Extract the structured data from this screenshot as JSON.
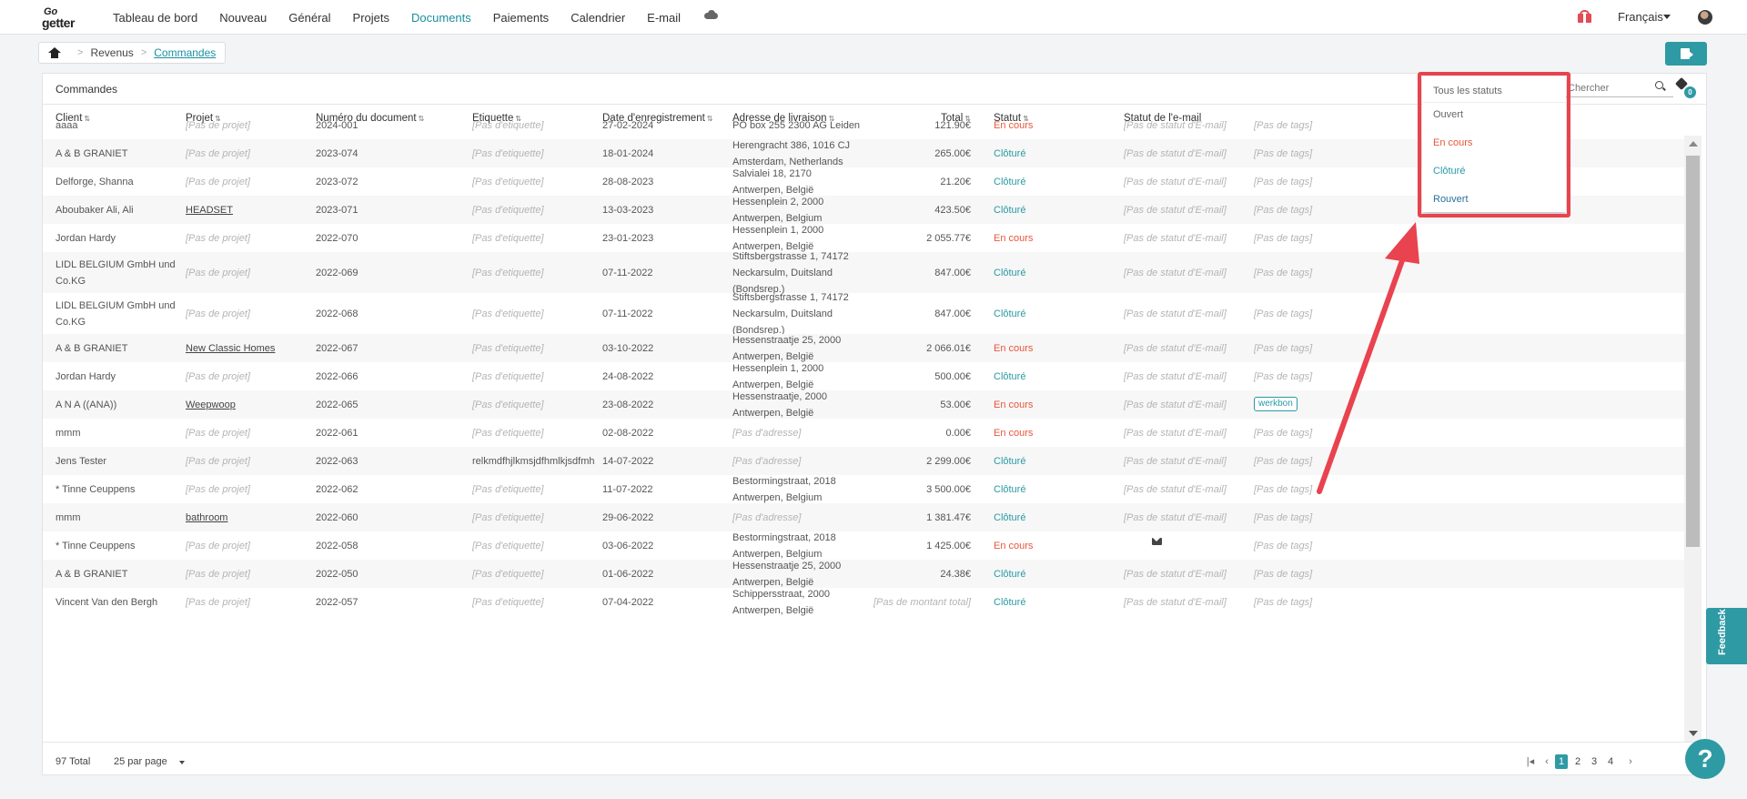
{
  "app": {
    "logo_top": "Go",
    "logo_bottom": "getter"
  },
  "nav": {
    "items": [
      "Tableau de bord",
      "Nouveau",
      "Général",
      "Projets",
      "Documents",
      "Paiements",
      "Calendrier",
      "E-mail"
    ],
    "active": "Documents",
    "language": "Français"
  },
  "breadcrumb": {
    "items": [
      "Revenus",
      "Commandes"
    ]
  },
  "panel": {
    "title": "Commandes",
    "search_placeholder": "Chercher",
    "tag_filter_count": "0"
  },
  "table": {
    "columns": [
      "Client",
      "Projet",
      "Numéro du document",
      "Etiquette",
      "Date d'enregistrement",
      "Adresse de livraison",
      "Total",
      "Statut",
      "Statut de l'e-mail",
      "Tags"
    ],
    "rows": [
      {
        "client": [
          "aaaa"
        ],
        "project": "[Pas de projet]",
        "number": "2024-001",
        "label": "[Pas d'etiquette]",
        "date": "27-02-2024",
        "address": [
          "PO box 255 2300 AG Leiden"
        ],
        "total": "121.90€",
        "status": "En cours",
        "email": "[Pas de statut d'E-mail]",
        "tags": "[Pas de tags]"
      },
      {
        "client": [
          "A & B GRANIET"
        ],
        "project": "[Pas de projet]",
        "number": "2023-074",
        "label": "[Pas d'etiquette]",
        "date": "18-01-2024",
        "address": [
          "Herengracht 386, 1016 CJ",
          "Amsterdam, Netherlands"
        ],
        "total": "265.00€",
        "status": "Clôturé",
        "email": "[Pas de statut d'E-mail]",
        "tags": "[Pas de tags]"
      },
      {
        "client": [
          "Delforge, Shanna"
        ],
        "project": "[Pas de projet]",
        "number": "2023-072",
        "label": "[Pas d'etiquette]",
        "date": "28-08-2023",
        "address": [
          "Salvialei 18, 2170",
          "Antwerpen, België"
        ],
        "total": "21.20€",
        "status": "Clôturé",
        "email": "[Pas de statut d'E-mail]",
        "tags": "[Pas de tags]"
      },
      {
        "client": [
          "Aboubaker Ali, Ali"
        ],
        "project": "HEADSET",
        "number": "2023-071",
        "label": "[Pas d'etiquette]",
        "date": "13-03-2023",
        "address": [
          "Hessenplein 2, 2000",
          "Antwerpen, Belgium"
        ],
        "total": "423.50€",
        "status": "Clôturé",
        "email": "[Pas de statut d'E-mail]",
        "tags": "[Pas de tags]"
      },
      {
        "client": [
          "Jordan Hardy"
        ],
        "project": "[Pas de projet]",
        "number": "2022-070",
        "label": "[Pas d'etiquette]",
        "date": "23-01-2023",
        "address": [
          "Hessenplein 1, 2000",
          "Antwerpen, België"
        ],
        "total": "2 055.77€",
        "status": "En cours",
        "email": "[Pas de statut d'E-mail]",
        "tags": "[Pas de tags]"
      },
      {
        "client": [
          "LIDL BELGIUM GmbH und",
          "Co.KG"
        ],
        "project": "[Pas de projet]",
        "number": "2022-069",
        "label": "[Pas d'etiquette]",
        "date": "07-11-2022",
        "address": [
          "Stiftsbergstrasse 1, 74172",
          "Neckarsulm, Duitsland",
          "(Bondsrep.)"
        ],
        "total": "847.00€",
        "status": "Clôturé",
        "email": "[Pas de statut d'E-mail]",
        "tags": "[Pas de tags]"
      },
      {
        "client": [
          "LIDL BELGIUM GmbH und",
          "Co.KG"
        ],
        "project": "[Pas de projet]",
        "number": "2022-068",
        "label": "[Pas d'etiquette]",
        "date": "07-11-2022",
        "address": [
          "Stiftsbergstrasse 1, 74172",
          "Neckarsulm, Duitsland",
          "(Bondsrep.)"
        ],
        "total": "847.00€",
        "status": "Clôturé",
        "email": "[Pas de statut d'E-mail]",
        "tags": "[Pas de tags]"
      },
      {
        "client": [
          "A & B GRANIET"
        ],
        "project": "New Classic Homes",
        "number": "2022-067",
        "label": "[Pas d'etiquette]",
        "date": "03-10-2022",
        "address": [
          "Hessenstraatje 25, 2000",
          "Antwerpen, België"
        ],
        "total": "2 066.01€",
        "status": "En cours",
        "email": "[Pas de statut d'E-mail]",
        "tags": "[Pas de tags]"
      },
      {
        "client": [
          "Jordan Hardy"
        ],
        "project": "[Pas de projet]",
        "number": "2022-066",
        "label": "[Pas d'etiquette]",
        "date": "24-08-2022",
        "address": [
          "Hessenplein 1, 2000",
          "Antwerpen, België"
        ],
        "total": "500.00€",
        "status": "Clôturé",
        "email": "[Pas de statut d'E-mail]",
        "tags": "[Pas de tags]"
      },
      {
        "client": [
          "A N A ((ANA))"
        ],
        "project": "Weepwoop",
        "number": "2022-065",
        "label": "[Pas d'etiquette]",
        "date": "23-08-2022",
        "address": [
          "Hessenstraatje, 2000",
          "Antwerpen, België"
        ],
        "total": "53.00€",
        "status": "En cours",
        "email": "[Pas de statut d'E-mail]",
        "tags": "werkbon"
      },
      {
        "client": [
          "mmm"
        ],
        "project": "[Pas de projet]",
        "number": "2022-061",
        "label": "[Pas d'etiquette]",
        "date": "02-08-2022",
        "address": [
          "[Pas d'adresse]"
        ],
        "total": "0.00€",
        "status": "En cours",
        "email": "[Pas de statut d'E-mail]",
        "tags": "[Pas de tags]"
      },
      {
        "client": [
          "Jens Tester"
        ],
        "project": "[Pas de projet]",
        "number": "2022-063",
        "label": "relkmdfhjlkmsjdfhmlkjsdfmh",
        "date": "14-07-2022",
        "address": [
          "[Pas d'adresse]"
        ],
        "total": "2 299.00€",
        "status": "Clôturé",
        "email": "[Pas de statut d'E-mail]",
        "tags": "[Pas de tags]"
      },
      {
        "client": [
          "* Tinne Ceuppens"
        ],
        "project": "[Pas de projet]",
        "number": "2022-062",
        "label": "[Pas d'etiquette]",
        "date": "11-07-2022",
        "address": [
          "Bestormingstraat, 2018",
          "Antwerpen, Belgium"
        ],
        "total": "3 500.00€",
        "status": "Clôturé",
        "email": "[Pas de statut d'E-mail]",
        "tags": "[Pas de tags]"
      },
      {
        "client": [
          "mmm"
        ],
        "project": "bathroom",
        "number": "2022-060",
        "label": "[Pas d'etiquette]",
        "date": "29-06-2022",
        "address": [
          "[Pas d'adresse]"
        ],
        "total": "1 381.47€",
        "status": "Clôturé",
        "email": "[Pas de statut d'E-mail]",
        "tags": "[Pas de tags]"
      },
      {
        "client": [
          "* Tinne Ceuppens"
        ],
        "project": "[Pas de projet]",
        "number": "2022-058",
        "label": "[Pas d'etiquette]",
        "date": "03-06-2022",
        "address": [
          "Bestormingstraat, 2018",
          "Antwerpen, Belgium"
        ],
        "total": "1 425.00€",
        "status": "En cours",
        "email": "",
        "tags": "[Pas de tags]"
      },
      {
        "client": [
          "A & B GRANIET"
        ],
        "project": "[Pas de projet]",
        "number": "2022-050",
        "label": "[Pas d'etiquette]",
        "date": "01-06-2022",
        "address": [
          "Hessenstraatje 25, 2000",
          "Antwerpen, België"
        ],
        "total": "24.38€",
        "status": "Clôturé",
        "email": "[Pas de statut d'E-mail]",
        "tags": "[Pas de tags]"
      },
      {
        "client": [
          "Vincent Van den Bergh"
        ],
        "project": "[Pas de projet]",
        "number": "2022-057",
        "label": "[Pas d'etiquette]",
        "date": "07-04-2022",
        "address": [
          "Schippersstraat, 2000",
          "Antwerpen, België"
        ],
        "total": "[Pas de montant total]",
        "status": "Clôturé",
        "email": "[Pas de statut d'E-mail]",
        "tags": "[Pas de tags]"
      }
    ]
  },
  "status_dropdown": {
    "items": [
      {
        "label": "Tous les statuts",
        "color": "#666666"
      },
      {
        "label": "Ouvert",
        "color": "#666666"
      },
      {
        "label": "En cours",
        "color": "#e8563c"
      },
      {
        "label": "Clôturé",
        "color": "#2a9aa4"
      },
      {
        "label": "Rouvert",
        "color": "#2a6f9a"
      }
    ]
  },
  "footer": {
    "total": "97 Total",
    "per_page": "25 par page",
    "pages": [
      "1",
      "2",
      "3",
      "4"
    ],
    "current_page": "1"
  },
  "feedback_label": "Feedback",
  "help_label": "?",
  "colors": {
    "accent": "#2e9aa4",
    "status_open": "#e8563c",
    "status_closed": "#2a9aa4",
    "annotation": "#e8434f"
  }
}
